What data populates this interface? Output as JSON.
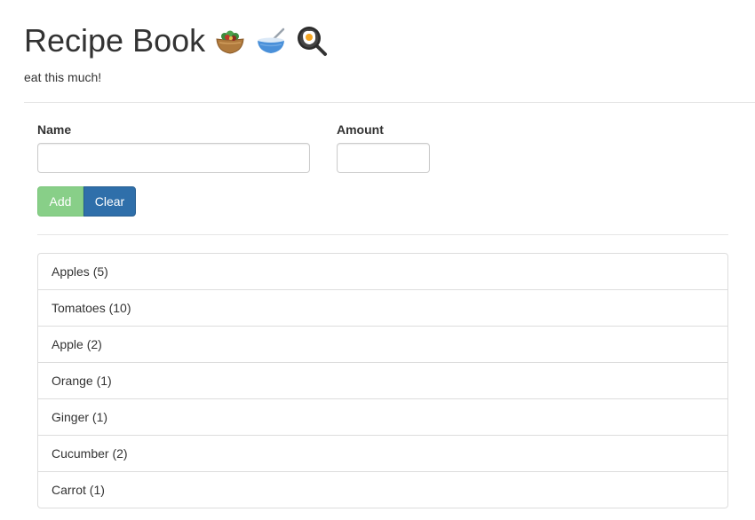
{
  "app": {
    "title": "Recipe Book",
    "emoji_icons": [
      "salad-bowl-icon",
      "bowl-with-spoon-icon",
      "frying-pan-egg-icon"
    ],
    "subtitle": "eat this much!"
  },
  "form": {
    "name_label": "Name",
    "name_value": "",
    "amount_label": "Amount",
    "amount_value": "",
    "add_label": "Add",
    "clear_label": "Clear"
  },
  "ingredients": [
    "Apples (5)",
    "Tomatoes (10)",
    "Apple (2)",
    "Orange (1)",
    "Ginger (1)",
    "Cucumber (2)",
    "Carrot (1)"
  ],
  "colors": {
    "add_button": "#88cf88",
    "clear_button": "#2f6faa",
    "border": "#dddddd",
    "text": "#333333"
  }
}
